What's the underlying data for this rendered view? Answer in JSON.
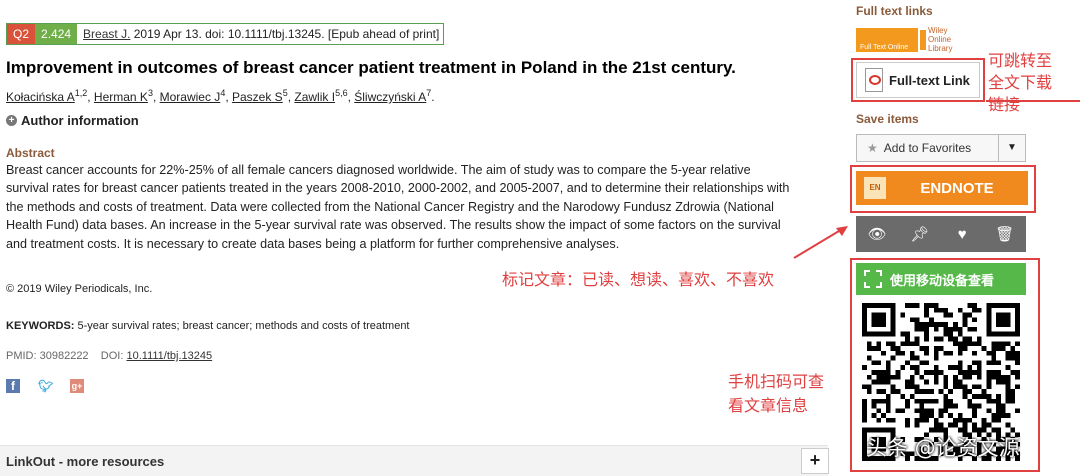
{
  "citation": {
    "quartile": "Q2",
    "impact_factor": "2.424",
    "journal": "Breast J.",
    "details": " 2019 Apr 13. doi: 10.1111/tbj.13245. [Epub ahead of print]"
  },
  "article": {
    "title": "Improvement in outcomes of breast cancer patient treatment in Poland in the 21st century.",
    "authors": [
      {
        "name": "Kołacińska A",
        "sup": "1,2"
      },
      {
        "name": "Herman K",
        "sup": "3"
      },
      {
        "name": "Morawiec J",
        "sup": "4"
      },
      {
        "name": "Paszek S",
        "sup": "5"
      },
      {
        "name": "Zawlik I",
        "sup": "5,6"
      },
      {
        "name": "Śliwczyński A",
        "sup": "7"
      }
    ],
    "author_info_label": "Author information",
    "abstract_heading": "Abstract",
    "abstract_text": "Breast cancer accounts for 22%-25% of all female cancers diagnosed worldwide. The aim of study was to compare the 5-year relative survival rates for breast cancer patients treated in the years 2008-2010, 2000-2002, and 2005-2007, and to determine their relationships with the methods and costs of treatment. Data were collected from the National Cancer Registry and the Narodowy Fundusz Zdrowia (National Health Fund) data bases. An increase in the 5-year survival rate was observed. The results show the impact of some factors on the survival and treatment costs. It is necessary to create data bases being a platform for further comprehensive analyses.",
    "copyright": "© 2019 Wiley Periodicals, Inc.",
    "keywords_label": "KEYWORDS:",
    "keywords": " 5-year survival rates; breast cancer; methods and costs of treatment",
    "pmid_label": "PMID: 30982222",
    "doi_label": "DOI:",
    "doi_value": "10.1111/tbj.13245"
  },
  "linkout": {
    "label": "LinkOut - more resources",
    "button": "+"
  },
  "sidebar": {
    "full_text_heading": "Full text links",
    "full_text_logo_label": "Full Text Online",
    "wiley_lines": [
      "Wiley",
      "Online",
      "Library"
    ],
    "full_text_link": "Full-text Link",
    "save_heading": "Save items",
    "favorites": "Add to Favorites",
    "endnote_icon": "EN",
    "endnote": "ENDNOTE",
    "mobile_button": "使用移动设备查看"
  },
  "annotations": {
    "fulltext_note": [
      "可跳转至",
      "全文下载",
      "链接"
    ],
    "mark_note": "标记文章：已读、想读、喜欢、不喜欢",
    "scan_note": [
      "手机扫码可查",
      "看文章信息"
    ],
    "watermark": "头条 @论资文源"
  },
  "colors": {
    "quartile_bg": "#d9533b",
    "impact_bg": "#6fae48",
    "endnote_bg": "#f08a1e",
    "mobile_bg": "#57b84a",
    "annotation": "#e04040",
    "heading_brown": "#8a5a3a"
  },
  "icons": [
    "plus-circle-icon",
    "facebook-icon",
    "twitter-icon",
    "google-plus-icon",
    "pdf-icon",
    "star-icon",
    "chevron-down-icon",
    "endnote-icon",
    "eye-icon",
    "pin-icon",
    "heart-icon",
    "trash-icon",
    "scan-icon",
    "qr-code-icon",
    "plus-icon"
  ]
}
